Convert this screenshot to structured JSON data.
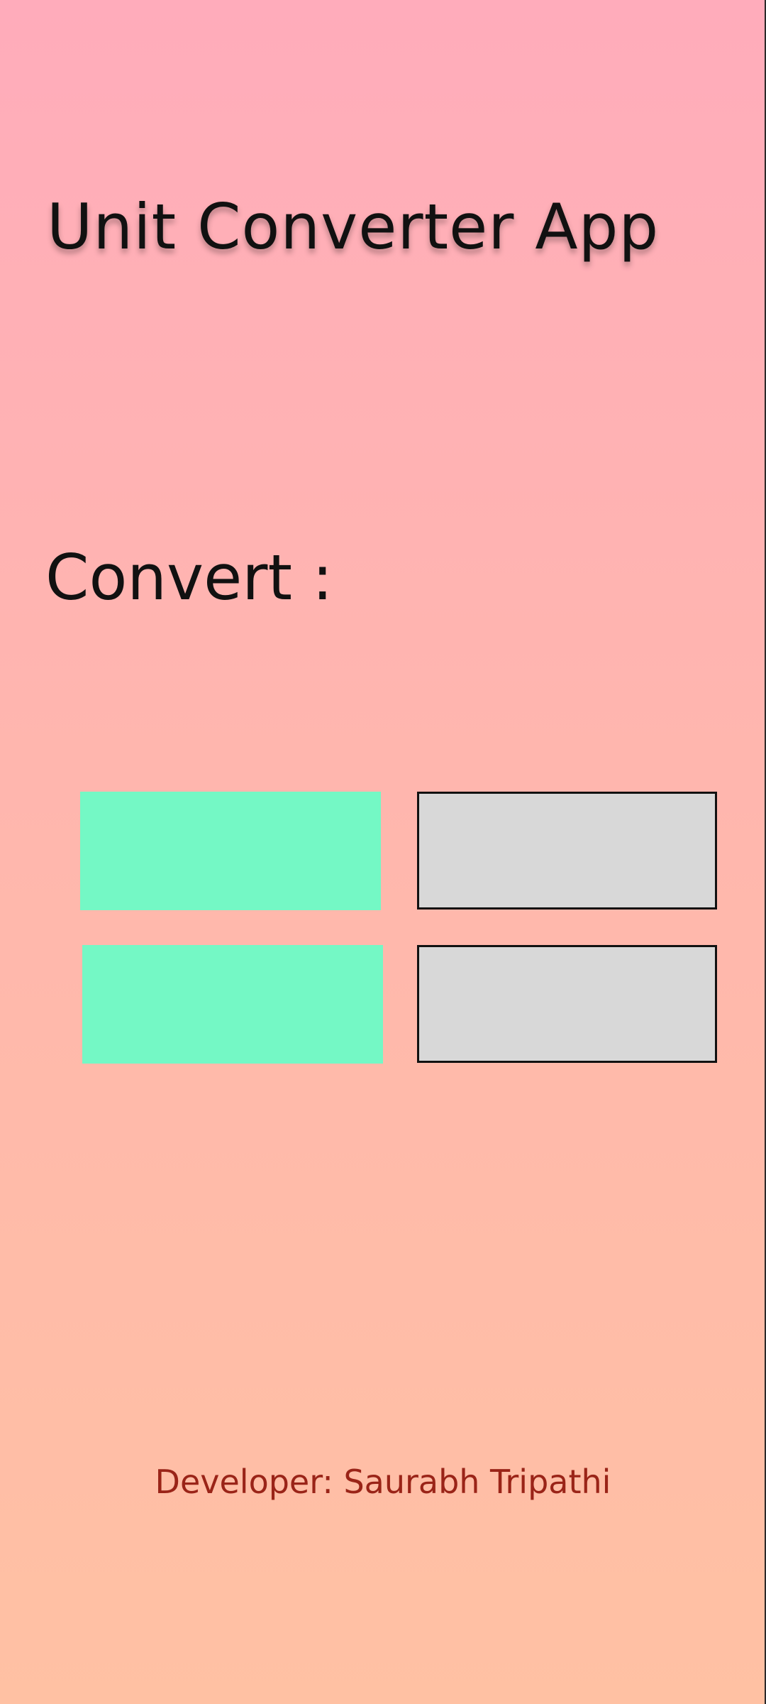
{
  "app": {
    "title": "Unit Converter App"
  },
  "converter": {
    "label": "Convert :",
    "source_buttons": [
      {
        "label": ""
      },
      {
        "label": ""
      }
    ],
    "fields": [
      {
        "value": "",
        "placeholder": ""
      },
      {
        "value": "",
        "placeholder": ""
      }
    ]
  },
  "footer": {
    "developer_text": "Developer: Saurabh Tripathi"
  },
  "colors": {
    "background_top": "#ffacbb",
    "background_bottom": "#ffc1a3",
    "button_fill": "#74f8c5",
    "field_fill": "#d8d8d8",
    "field_border": "#111111",
    "footer_text": "#9a2418",
    "title_text": "#111111"
  }
}
